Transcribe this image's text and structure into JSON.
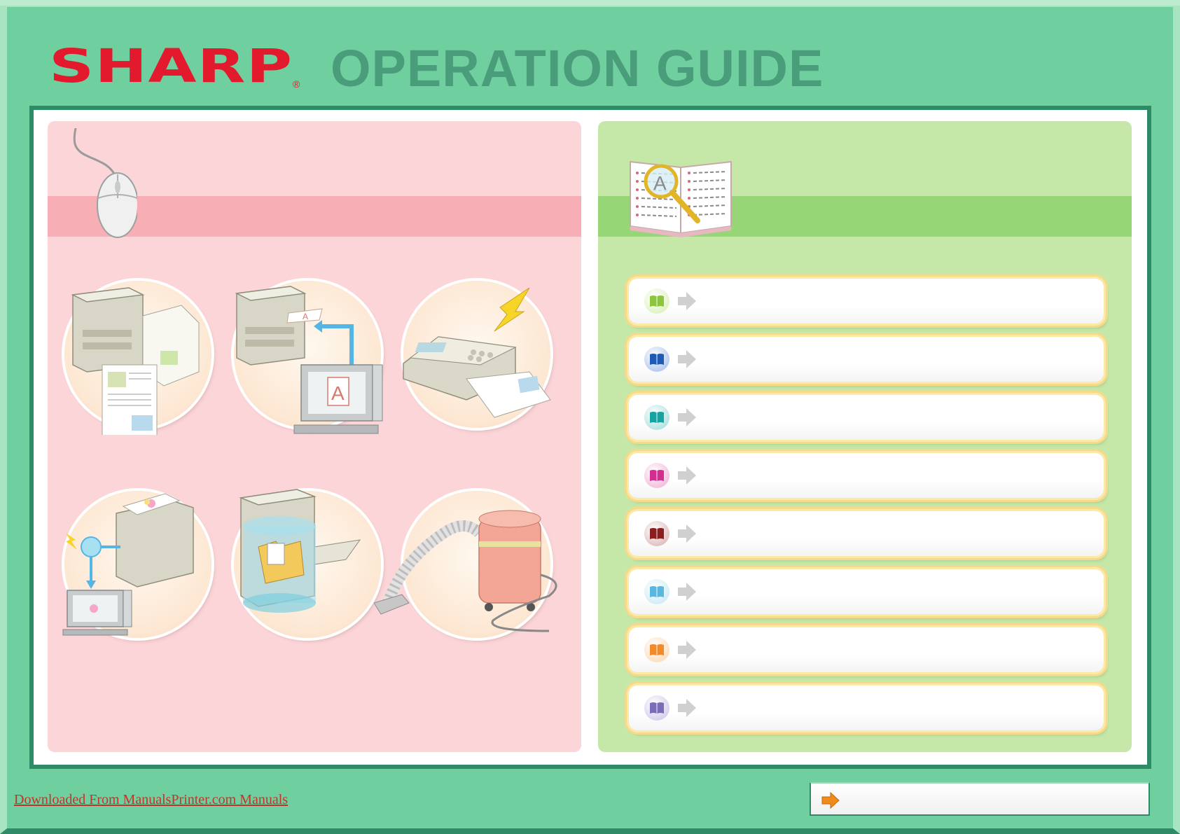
{
  "header": {
    "logo_text": "SHARP",
    "logo_reg": "®",
    "title": "OPERATION GUIDE"
  },
  "left_panel": {
    "header_icon": "mouse-icon",
    "features": [
      {
        "icon": "copier-icon"
      },
      {
        "icon": "printer-icon"
      },
      {
        "icon": "fax-icon"
      },
      {
        "icon": "scanner-icon"
      },
      {
        "icon": "document-filing-icon"
      },
      {
        "icon": "maintenance-icon"
      }
    ]
  },
  "right_panel": {
    "header_icon": "book-magnifier-icon",
    "manuals": [
      {
        "label": "",
        "color": "#8cc63f",
        "bg": "#e3f3c7"
      },
      {
        "label": "",
        "color": "#1f5bb5",
        "bg": "#b9cdf0"
      },
      {
        "label": "",
        "color": "#17a3a1",
        "bg": "#b5e6e3"
      },
      {
        "label": "",
        "color": "#d22d8f",
        "bg": "#f5c2e0"
      },
      {
        "label": "",
        "color": "#8a1f1f",
        "bg": "#e3c4c4"
      },
      {
        "label": "",
        "color": "#5ab8e0",
        "bg": "#d2eef8"
      },
      {
        "label": "",
        "color": "#f08a2a",
        "bg": "#fde0c2"
      },
      {
        "label": "",
        "color": "#7b6bb8",
        "bg": "#d9d2ee"
      }
    ]
  },
  "footer": {
    "link_text": "Downloaded From ManualsPrinter.com Manuals",
    "button_label": "",
    "button_icon": "orange-arrow-icon"
  },
  "colors": {
    "frame": "#6fcf9f",
    "accent_dark": "#2f8a68",
    "brand_red": "#e3192e",
    "title_green": "#4a9d7a"
  }
}
